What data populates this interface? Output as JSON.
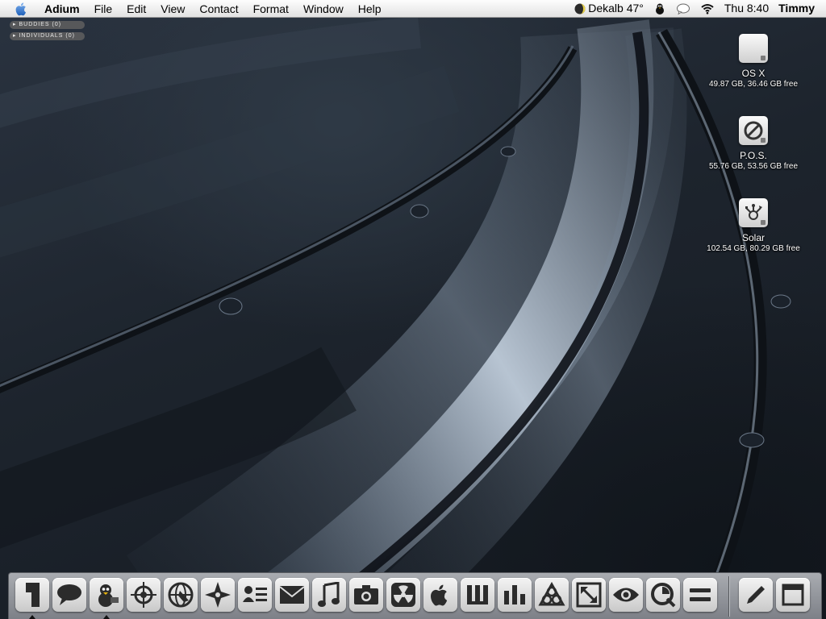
{
  "menubar": {
    "app_name": "Adium",
    "menus": [
      "File",
      "Edit",
      "View",
      "Contact",
      "Format",
      "Window",
      "Help"
    ],
    "weather": "Dekalb 47°",
    "clock": "Thu 8:40",
    "user": "Timmy"
  },
  "adium": {
    "groups": [
      "BUDDIES (0)",
      "INDIVIDUALS (0)"
    ]
  },
  "desktop": {
    "volumes": [
      {
        "name": "OS X",
        "info": "49.87 GB, 36.46 GB free",
        "icon": "hard-drive-icon"
      },
      {
        "name": "P.O.S.",
        "info": "55.76 GB, 53.56 GB free",
        "icon": "no-symbol-drive-icon"
      },
      {
        "name": "Solar",
        "info": "102.54 GB, 80.29 GB free",
        "icon": "firewire-drive-icon"
      }
    ]
  },
  "dock": {
    "apps": [
      "finder-icon",
      "adium-chat-icon",
      "adium-duck-icon",
      "crosshair-icon",
      "globe-icon",
      "compass-icon",
      "address-book-icon",
      "mail-icon",
      "itunes-icon",
      "iphoto-icon",
      "radiation-icon",
      "apple-icon",
      "text-editor-icon",
      "activity-bars-icon",
      "trefoil-icon",
      "resize-arrows-icon",
      "eye-icon",
      "quicktime-icon",
      "equals-icon"
    ],
    "extras": [
      "pencil-icon",
      "window-icon"
    ],
    "running": [
      "finder-icon",
      "adium-duck-icon"
    ]
  },
  "colors": {
    "menubar": "#ececec",
    "dock": "#9a9da2",
    "wallpaper": "#1d242d",
    "accent": "#c8d6e6"
  }
}
